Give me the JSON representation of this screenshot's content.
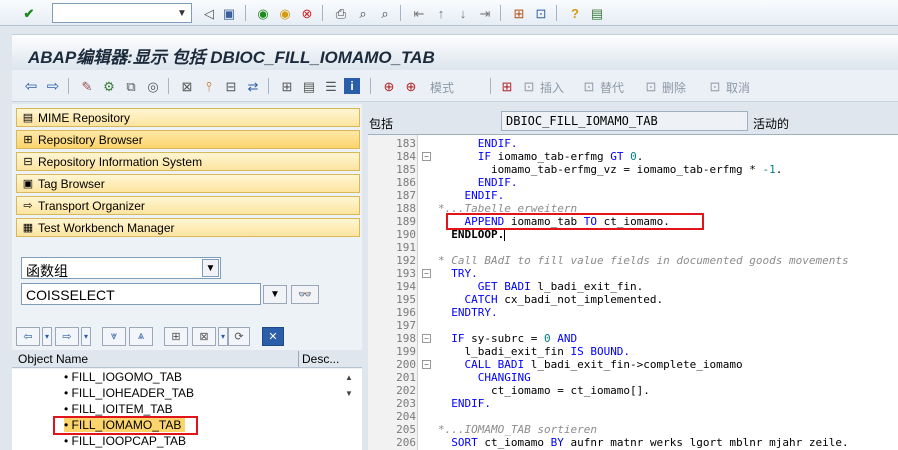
{
  "command_field": {
    "value": ""
  },
  "window": {
    "title": "ABAP编辑器:显示 包括 DBIOC_FILL_IOMAMO_TAB"
  },
  "app_toolbar": {
    "btn_mode": "模式",
    "btn_insert": "插入",
    "btn_replace": "替代",
    "btn_delete": "删除",
    "btn_cancel": "取消"
  },
  "nav_buttons": [
    {
      "label": "MIME Repository"
    },
    {
      "label": "Repository Browser"
    },
    {
      "label": "Repository Information System"
    },
    {
      "label": "Tag Browser"
    },
    {
      "label": "Transport Organizer"
    },
    {
      "label": "Test Workbench Manager"
    }
  ],
  "object_type_select": {
    "value": "函数组"
  },
  "object_name_input": {
    "value": "COISSELECT"
  },
  "tree": {
    "headers": {
      "name": "Object Name",
      "desc": "Desc..."
    },
    "items": [
      "FILL_IOGOMO_TAB",
      "FILL_IOHEADER_TAB",
      "FILL_IOITEM_TAB",
      "FILL_IOMAMO_TAB",
      "FILL_IOOPCAP_TAB"
    ],
    "selected_index": 3
  },
  "editor_header": {
    "package_label": "包括",
    "include_name": "DBIOC_FILL_IOMAMO_TAB",
    "status": "活动的"
  },
  "code_lines": [
    {
      "no": "183",
      "parts": [
        {
          "t": "      ENDIF.",
          "c": "kw"
        }
      ]
    },
    {
      "no": "184",
      "parts": [
        {
          "t": "      IF ",
          "c": "kw"
        },
        {
          "t": "iomamo_tab-erfmg ",
          "c": ""
        },
        {
          "t": "GT ",
          "c": "kw"
        },
        {
          "t": "0",
          "c": "num"
        },
        {
          "t": ".",
          "c": ""
        }
      ]
    },
    {
      "no": "185",
      "parts": [
        {
          "t": "        iomamo_tab-erfmg_vz = iomamo_tab-erfmg * ",
          "c": ""
        },
        {
          "t": "-1",
          "c": "num"
        },
        {
          "t": ".",
          "c": ""
        }
      ]
    },
    {
      "no": "186",
      "parts": [
        {
          "t": "      ENDIF.",
          "c": "kw"
        }
      ]
    },
    {
      "no": "187",
      "parts": [
        {
          "t": "    ENDIF.",
          "c": "kw"
        }
      ]
    },
    {
      "no": "188",
      "parts": [
        {
          "t": "*...Tabelle erweitern",
          "c": "cm"
        }
      ]
    },
    {
      "no": "189",
      "parts": [
        {
          "t": "    APPEND ",
          "c": "kw"
        },
        {
          "t": "iomamo_tab ",
          "c": ""
        },
        {
          "t": "TO ",
          "c": "kw"
        },
        {
          "t": "ct_iomamo.",
          "c": ""
        }
      ]
    },
    {
      "no": "190",
      "parts": [
        {
          "t": "  ENDLOOP.",
          "c": "bold"
        }
      ]
    },
    {
      "no": "191",
      "parts": []
    },
    {
      "no": "192",
      "parts": [
        {
          "t": "* Call BAdI to fill value fields in documented goods movements",
          "c": "cm"
        }
      ]
    },
    {
      "no": "193",
      "parts": [
        {
          "t": "  TRY.",
          "c": "kw"
        }
      ]
    },
    {
      "no": "194",
      "parts": [
        {
          "t": "      GET BADI ",
          "c": "kw"
        },
        {
          "t": "l_badi_exit_fin.",
          "c": ""
        }
      ]
    },
    {
      "no": "195",
      "parts": [
        {
          "t": "    CATCH ",
          "c": "kw"
        },
        {
          "t": "cx_badi_not_implemented.",
          "c": ""
        }
      ]
    },
    {
      "no": "196",
      "parts": [
        {
          "t": "  ENDTRY.",
          "c": "kw"
        }
      ]
    },
    {
      "no": "197",
      "parts": []
    },
    {
      "no": "198",
      "parts": [
        {
          "t": "  IF ",
          "c": "kw"
        },
        {
          "t": "sy-subrc = ",
          "c": ""
        },
        {
          "t": "0 ",
          "c": "num"
        },
        {
          "t": "AND",
          "c": "kw"
        }
      ]
    },
    {
      "no": "199",
      "parts": [
        {
          "t": "    l_badi_exit_fin ",
          "c": ""
        },
        {
          "t": "IS BOUND.",
          "c": "kw"
        }
      ]
    },
    {
      "no": "200",
      "parts": [
        {
          "t": "    CALL BADI ",
          "c": "kw"
        },
        {
          "t": "l_badi_exit_fin->complete_iomamo",
          "c": ""
        }
      ]
    },
    {
      "no": "201",
      "parts": [
        {
          "t": "      CHANGING",
          "c": "kw"
        }
      ]
    },
    {
      "no": "202",
      "parts": [
        {
          "t": "        ct_iomamo = ct_iomamo[].",
          "c": ""
        }
      ]
    },
    {
      "no": "203",
      "parts": [
        {
          "t": "  ENDIF.",
          "c": "kw"
        }
      ]
    },
    {
      "no": "204",
      "parts": []
    },
    {
      "no": "205",
      "parts": [
        {
          "t": "*...IOMAMO_TAB sortieren",
          "c": "cm"
        }
      ]
    },
    {
      "no": "206",
      "parts": [
        {
          "t": "  SORT ",
          "c": "kw"
        },
        {
          "t": "ct_iomamo ",
          "c": ""
        },
        {
          "t": "BY ",
          "c": "kw"
        },
        {
          "t": "aufnr matnr werks lgort mblnr mjahr zeile.",
          "c": ""
        }
      ]
    }
  ],
  "colors": {
    "highlight": "#e0141a",
    "keyword": "#0000ff",
    "comment": "#8c8c8c",
    "number": "#008080",
    "nav_button": "#fde4a0",
    "tree_selected": "#fbd46b"
  }
}
